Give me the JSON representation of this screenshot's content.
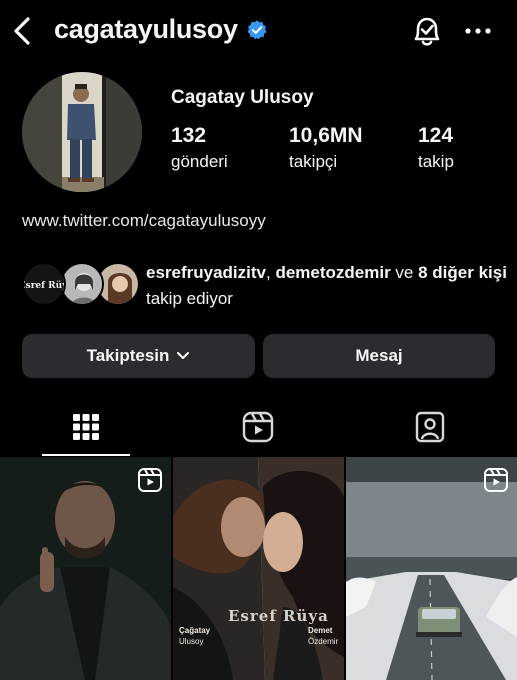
{
  "header": {
    "username": "cagatayulusoy",
    "icons": [
      "back-chevron-icon",
      "verified-badge-icon",
      "notification-bell-icon",
      "more-options-icon"
    ]
  },
  "profile": {
    "full_name": "Cagatay Ulusoy",
    "stats": [
      {
        "count": "132",
        "label": "gönderi"
      },
      {
        "count": "10,6MN",
        "label": "takipçi"
      },
      {
        "count": "124",
        "label": "takip"
      }
    ],
    "link": "www.twitter.com/cagatayulusoyy"
  },
  "mutual": {
    "name1": "esrefruyadizitv",
    "sep": ", ",
    "name2": "demetozdemir",
    "and": " ve ",
    "others": "8 diğer kişi",
    "suffix": " takip ediyor",
    "avatar1_text": "Esref Rüya"
  },
  "actions": {
    "follow_label": "Takiptesin",
    "message_label": "Mesaj"
  },
  "tabs": [
    "posts-grid-icon",
    "reels-icon",
    "tagged-icon"
  ],
  "grid": {
    "post2": {
      "title": "Esref Rüya",
      "left_name": "Çağatay",
      "left_surname": "Ulusoy",
      "right_name": "Demet",
      "right_surname": "Özdemir"
    }
  },
  "colors": {
    "background": "#000000",
    "button": "#2b2c31",
    "verified": "#3897f0",
    "text": "#f5f5f5"
  }
}
